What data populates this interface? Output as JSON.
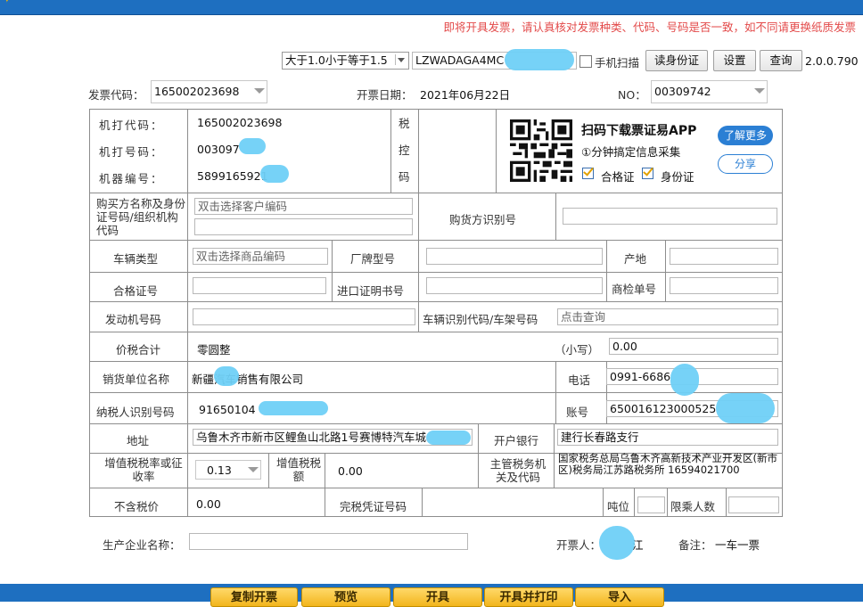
{
  "notice": "即将开具发票，请认真核对发票种类、代码、号码是否一致，如不同请更换纸质发票",
  "toolbar": {
    "range_select": "大于1.0小于等于1.5",
    "vin_input": "LZWADAGA4MC",
    "phone_scan_label": "手机扫描",
    "read_id_button": "读身份证",
    "settings_button": "设置",
    "query_button": "查询",
    "version": "2.0.0.790"
  },
  "invoice_header": {
    "code_label": "发票代码：",
    "code_value": "165002023698",
    "date_label": "开票日期：",
    "date_value": "2021年06月22日",
    "no_label": "NO：",
    "no_value": "00309742"
  },
  "machine": {
    "print_code_label": "机打代码：",
    "print_code_value": "165002023698",
    "print_no_label": "机打号码：",
    "print_no_value": "003097",
    "machine_no_label": "机器编号：",
    "machine_no_value": "5899165921",
    "tax_control_label": [
      "税",
      "控",
      "码"
    ]
  },
  "promo": {
    "title": "扫码下载票证易APP",
    "subtitle": "①分钟搞定信息采集",
    "check1": "合格证",
    "check2": "身份证",
    "learn_more": "了解更多",
    "share": "分享"
  },
  "form": {
    "buyer_label": "购买方名称及身份证号码/组织机构代码",
    "buyer_placeholder": "双击选择客户编码",
    "buyer_id_label": "购货方识别号",
    "vehicle_type_label": "车辆类型",
    "vehicle_type_placeholder": "双击选择商品编码",
    "brand_model_label": "厂牌型号",
    "origin_label": "产地",
    "cert_no_label": "合格证号",
    "import_cert_label": "进口证明书号",
    "inspection_no_label": "商检单号",
    "engine_no_label": "发动机号码",
    "vin_label": "车辆识别代码/车架号码",
    "vin_placeholder": "点击查询",
    "total_label": "价税合计",
    "total_words": "零圆整",
    "small_label": "（小写）",
    "small_value": "0.00",
    "seller_label": "销货单位名称",
    "seller_value": "新疆汽车销售有限公司",
    "phone_label": "电话",
    "phone_value": "0991-6686",
    "taxpayer_label": "纳税人识别号码",
    "taxpayer_value": "91650104",
    "account_label": "账号",
    "account_value": "650016123000525",
    "address_label": "地址",
    "address_value": "乌鲁木齐市新市区鲤鱼山北路1号赛博特汽车城",
    "bank_label": "开户银行",
    "bank_value": "建行长春路支行",
    "vat_rate_label": "增值税税率或征收率",
    "vat_rate_value": "0.13",
    "vat_amount_label": "增值税税额",
    "vat_amount_value": "0.00",
    "tax_authority_label": "主管税务机关及代码",
    "tax_authority_value": "国家税务总局乌鲁木齐高新技术产业开发区(新市区)税务局江苏路税务所 16594021700",
    "excl_tax_label": "不含税价",
    "excl_tax_value": "0.00",
    "tax_receipt_label": "完税凭证号码",
    "tonnage_label": "吨位",
    "passenger_label": "限乘人数"
  },
  "footer": {
    "manufacturer_label": "生产企业名称：",
    "issuer_label": "开票人：",
    "issuer_value": "江",
    "remark_label": "备注：",
    "remark_value": "一车一票"
  },
  "actions": [
    "复制开票",
    "预览",
    "开具",
    "开具并打印",
    "导入"
  ],
  "colors": {
    "accent": "#1e6fc0",
    "notice": "#e34a4a",
    "button": "#f2b51c"
  }
}
